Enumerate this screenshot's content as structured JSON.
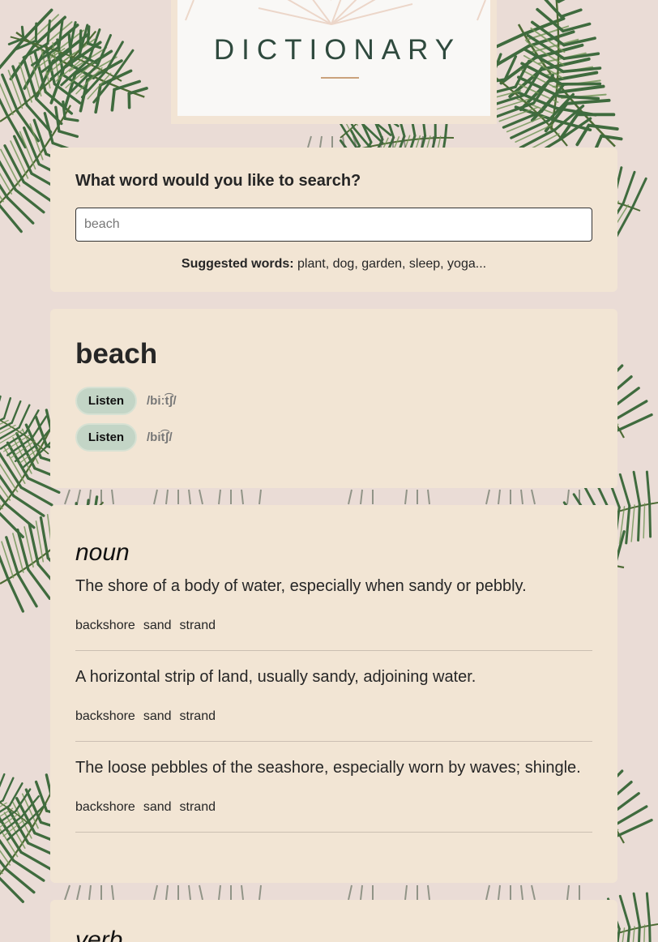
{
  "header": {
    "title": "DICTIONARY"
  },
  "search": {
    "question": "What word would you like to search?",
    "value": "beach",
    "placeholder": "beach",
    "suggested_label": "Suggested words:",
    "suggested_words": "plant, dog, garden, sleep, yoga..."
  },
  "word": {
    "title": "beach",
    "phonetics": [
      {
        "listen_label": "Listen",
        "text": "/biːt͡ʃ/"
      },
      {
        "listen_label": "Listen",
        "text": "/bit͡ʃ/"
      }
    ]
  },
  "meanings": [
    {
      "part_of_speech": "noun",
      "definitions": [
        {
          "text": "The shore of a body of water, especially when sandy or pebbly.",
          "synonyms": [
            "backshore",
            "sand",
            "strand"
          ]
        },
        {
          "text": "A horizontal strip of land, usually sandy, adjoining water.",
          "synonyms": [
            "backshore",
            "sand",
            "strand"
          ]
        },
        {
          "text": "The loose pebbles of the seashore, especially worn by waves; shingle.",
          "synonyms": [
            "backshore",
            "sand",
            "strand"
          ]
        }
      ]
    },
    {
      "part_of_speech": "verb"
    }
  ],
  "colors": {
    "background": "#eadcd6",
    "card": "#f2e5d4",
    "title_green": "#2f4a3e",
    "accent_gold": "#caa27c",
    "listen_button": "#c3d5c6",
    "leaf_green": "#3f6b3e"
  }
}
